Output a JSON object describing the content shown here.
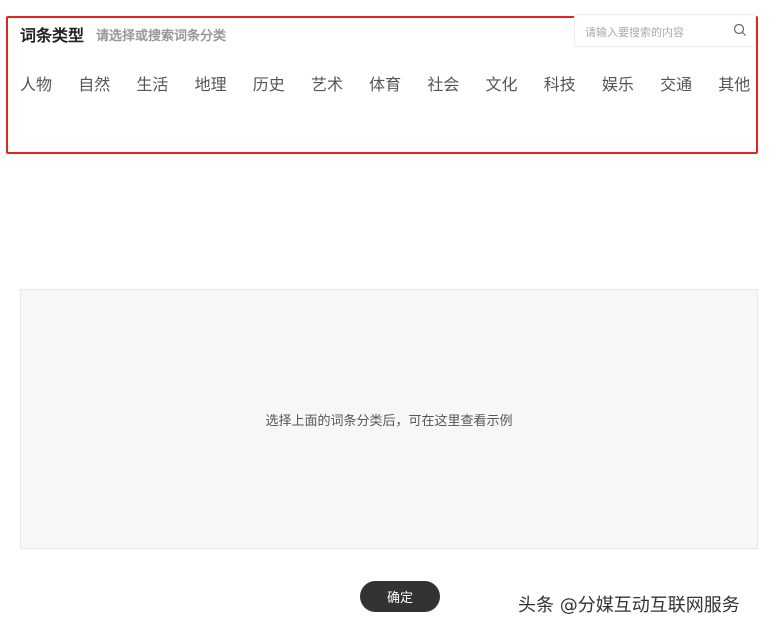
{
  "header": {
    "title": "词条类型",
    "subtitle": "请选择或搜索词条分类"
  },
  "search": {
    "placeholder": "请输入要搜索的内容",
    "icon": "search-icon"
  },
  "categories": [
    "人物",
    "自然",
    "生活",
    "地理",
    "历史",
    "艺术",
    "体育",
    "社会",
    "文化",
    "科技",
    "娱乐",
    "交通",
    "其他"
  ],
  "preview": {
    "hint": "选择上面的词条分类后，可在这里查看示例"
  },
  "confirm_label": "确定",
  "watermark": "头条 @分媒互动互联网服务",
  "colors": {
    "highlight": "#e0261d",
    "button": "#333333"
  }
}
